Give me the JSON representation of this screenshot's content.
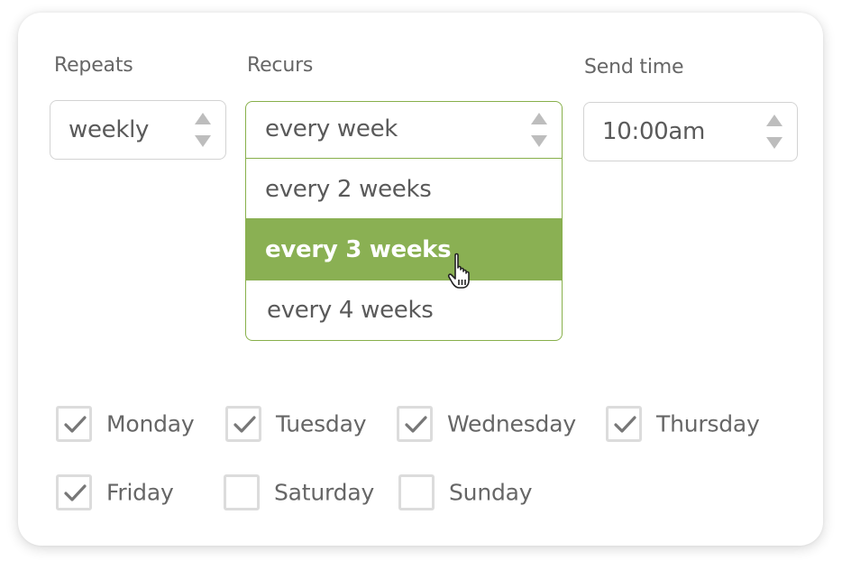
{
  "repeats": {
    "label": "Repeats",
    "value": "weekly"
  },
  "recurs": {
    "label": "Recurs",
    "value": "every week",
    "options": [
      {
        "label": "every 2 weeks",
        "selected": false
      },
      {
        "label": "every 3 weeks",
        "selected": true
      },
      {
        "label": "every 4 weeks",
        "selected": false
      }
    ]
  },
  "send_time": {
    "label": "Send time",
    "value": "10:00am"
  },
  "days": [
    {
      "label": "Monday",
      "checked": true
    },
    {
      "label": "Tuesday",
      "checked": true
    },
    {
      "label": "Wednesday",
      "checked": true
    },
    {
      "label": "Thursday",
      "checked": true
    },
    {
      "label": "Friday",
      "checked": true
    },
    {
      "label": "Saturday",
      "checked": false
    },
    {
      "label": "Sunday",
      "checked": false
    }
  ],
  "colors": {
    "accent": "#8ab053",
    "text": "#5a5a5a",
    "border": "#d3d3d3",
    "checkmark": "#777777"
  },
  "icons": {
    "spinner": "up-down-arrows-icon",
    "check": "checkmark-icon",
    "cursor": "hand-pointer-icon"
  }
}
